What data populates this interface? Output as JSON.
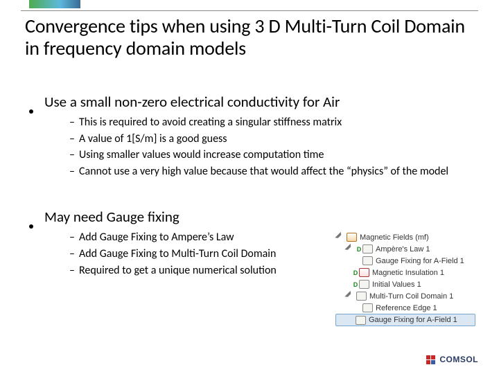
{
  "title": "Convergence tips when using 3 D Multi-Turn Coil Domain in frequency domain models",
  "point1": {
    "heading": "Use a small non-zero electrical conductivity for Air",
    "subs": [
      "This is required to avoid creating a singular stiffness matrix",
      "A value of 1[S/m] is a good guess",
      "Using smaller values would increase computation time",
      "Cannot use a very high value because that would affect the “physics” of the model"
    ]
  },
  "point2": {
    "heading": "May need Gauge fixing",
    "subs": [
      "Add Gauge Fixing to Ampere’s Law",
      "Add Gauge Fixing to Multi-Turn Coil Domain",
      "Required to get a unique numerical solution"
    ]
  },
  "tree": {
    "root": "Magnetic Fields (mf)",
    "items": [
      "Ampère's Law 1",
      "Gauge Fixing for A-Field 1",
      "Magnetic Insulation 1",
      "Initial Values 1",
      "Multi-Turn Coil Domain 1",
      "Reference Edge 1",
      "Gauge Fixing for A-Field 1"
    ]
  },
  "footer": {
    "brand": "COMSOL"
  }
}
